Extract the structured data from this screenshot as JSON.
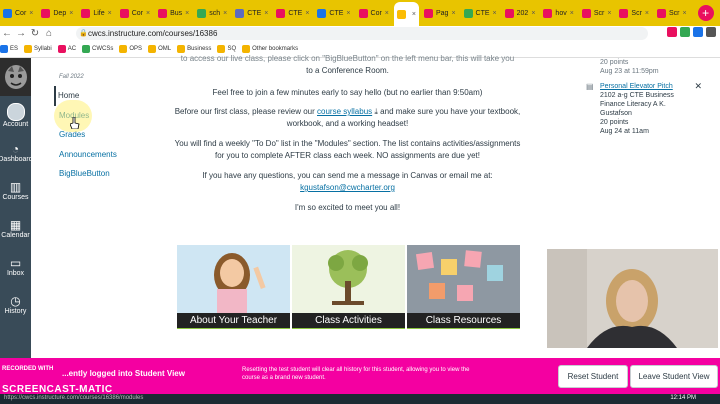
{
  "browser": {
    "tabs": [
      {
        "label": "Cor",
        "color": "#1a73e8"
      },
      {
        "label": "Dep",
        "color": "#e9105f"
      },
      {
        "label": "Life",
        "color": "#e9105f"
      },
      {
        "label": "Cor",
        "color": "#e9105f"
      },
      {
        "label": "Bus",
        "color": "#e9105f"
      },
      {
        "label": "sch",
        "color": "#34a853"
      },
      {
        "label": "CTE",
        "color": "#5c6bc0"
      },
      {
        "label": "CTE",
        "color": "#e9105f"
      },
      {
        "label": "CTE",
        "color": "#1a73e8"
      },
      {
        "label": "Cor",
        "color": "#e9105f"
      },
      {
        "label": "",
        "color": "#fbbc04"
      },
      {
        "label": "Pag",
        "color": "#e9105f"
      },
      {
        "label": "CTE",
        "color": "#34a853"
      },
      {
        "label": "202",
        "color": "#e9105f"
      },
      {
        "label": "hov",
        "color": "#e9105f"
      },
      {
        "label": "Scr",
        "color": "#e9105f"
      },
      {
        "label": "Scr",
        "color": "#e9105f"
      },
      {
        "label": "Scr",
        "color": "#e9105f"
      }
    ],
    "url": "cwcs.instructure.com/courses/16386",
    "bookmarks": [
      "ES",
      "Syllabi",
      "AC",
      "CWCSs",
      "OPS",
      "OML",
      "Business",
      "SQ",
      "Other bookmarks"
    ]
  },
  "global_nav": {
    "items": [
      {
        "label": "Account",
        "icon": "avatar-icon"
      },
      {
        "label": "Dashboard",
        "icon": "dashboard-icon"
      },
      {
        "label": "Courses",
        "icon": "courses-icon"
      },
      {
        "label": "Calendar",
        "icon": "calendar-icon"
      },
      {
        "label": "Inbox",
        "icon": "inbox-icon"
      },
      {
        "label": "History",
        "icon": "history-icon"
      }
    ]
  },
  "course_nav": {
    "term": "Fall 2022",
    "items": [
      "Home",
      "Modules",
      "Grades",
      "Announcements",
      "BigBlueButton"
    ]
  },
  "content": {
    "line_top": "to access our live class, please click on \"BigBlueButton\" on the left menu bar, this will take you",
    "line_top2": "to a Conference Room.",
    "line_join": "Feel free to join a few minutes early to say hello (but no earlier than 9:50am)",
    "syllabus_pre": "Before our first class, please review our",
    "syllabus_link": "course syllabus",
    "syllabus_post": "and make sure you have your textbook,",
    "syllabus_line2": "workbook, and a working headset!",
    "todo_line1": "You will find a weekly \"To Do\" list in the \"Modules\" section.  The list contains activities/assignments",
    "todo_line2": "for you to complete AFTER class each week.  NO assignments are due yet!",
    "question_line": "If you have any questions, you can send me a message in Canvas or email me at:",
    "email": "kgustafson@cwcharter.org",
    "closing": "I'm so excited to meet you all!"
  },
  "tiles": [
    "About Your Teacher",
    "Class Activities",
    "Class Resources"
  ],
  "todo_sidebar": {
    "top_points": "20 points",
    "top_due": "Aug 23 at 11:59pm",
    "item_title": "Personal Elevator Pitch",
    "item_course": "2102 a-g CTE Business Finance Literacy A K. Gustafson",
    "item_points": "20 points",
    "item_due": "Aug 24 at 11am"
  },
  "student_view_bar": {
    "status": "...ently logged into Student View",
    "message": "Resetting the test student will clear all history for this student, allowing you to view the course as a brand new student.",
    "reset_label": "Reset Student",
    "leave_label": "Leave Student View"
  },
  "recording": {
    "recorded_with": "RECORDED WITH",
    "brand": "SCREENCAST-MATIC",
    "url_hint": "https://cwcs.instructure.com/courses/16386/modules"
  },
  "taskbar": {
    "time": "12:14 PM"
  }
}
